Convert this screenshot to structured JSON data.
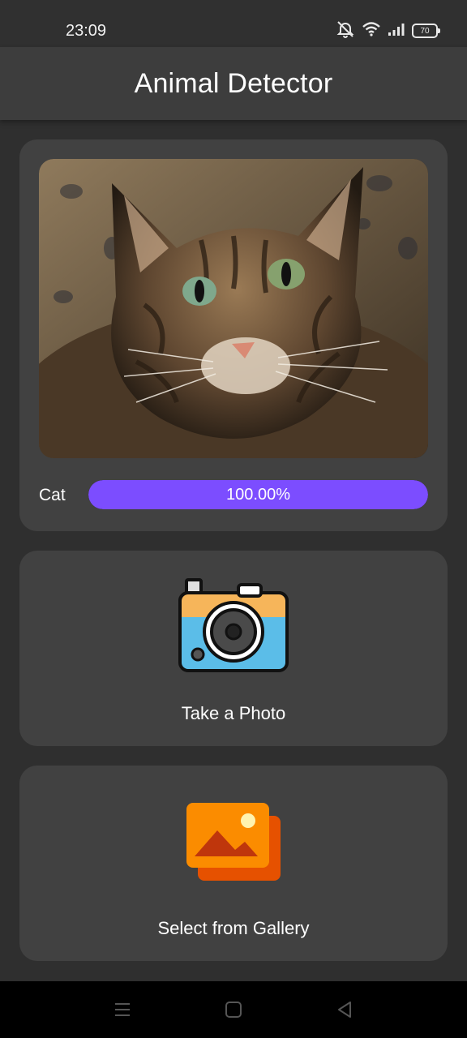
{
  "status_bar": {
    "time": "23:09",
    "battery": "70",
    "icons": [
      "mute-bell-icon",
      "wifi-icon",
      "signal-icon",
      "battery-icon"
    ]
  },
  "app_bar": {
    "title": "Animal Detector"
  },
  "result": {
    "label": "Cat",
    "confidence_text": "100.00%",
    "confidence_fraction": 1.0,
    "bar_color": "#7c4dff"
  },
  "actions": {
    "camera_label": "Take a Photo",
    "gallery_label": "Select from Gallery"
  },
  "nav_bar": {
    "icons": [
      "menu-icon",
      "home-icon",
      "back-icon"
    ]
  },
  "colors": {
    "background": "#2f2f2f",
    "card": "#414141",
    "app_bar": "#3d3d3d",
    "accent": "#7c4dff"
  }
}
